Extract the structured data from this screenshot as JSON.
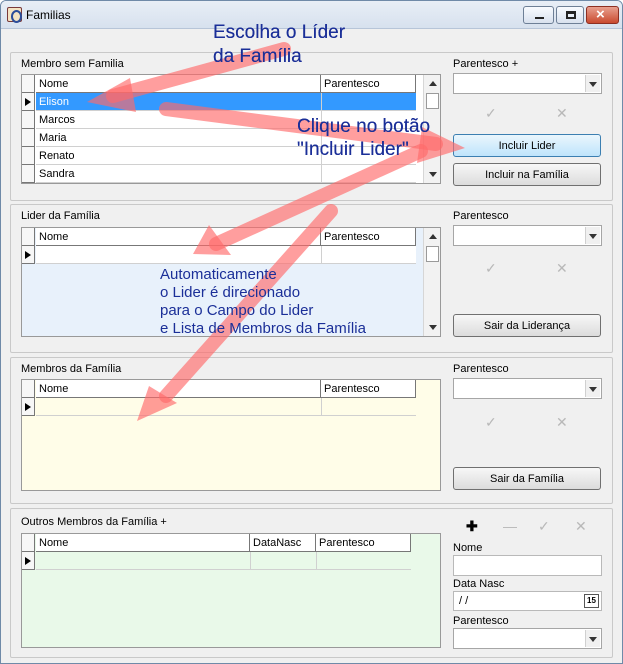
{
  "window": {
    "title": "Familias"
  },
  "membro_sem_familia": {
    "label": "Membro sem Familia",
    "columns": [
      "Nome",
      "Parentesco"
    ],
    "rows": [
      {
        "nome": "Elison",
        "parentesco": ""
      },
      {
        "nome": "Marcos",
        "parentesco": ""
      },
      {
        "nome": "Maria",
        "parentesco": ""
      },
      {
        "nome": "Renato",
        "parentesco": ""
      },
      {
        "nome": "Sandra",
        "parentesco": ""
      }
    ]
  },
  "parentesco_plus": {
    "label": "Parentesco +",
    "value": ""
  },
  "buttons": {
    "incluir_lider": "Incluir Lider",
    "incluir_familia": "Incluir na Família",
    "sair_lideranca": "Sair da Liderança",
    "sair_familia": "Sair da Família"
  },
  "lider": {
    "label": "Lider da Família",
    "columns": [
      "Nome",
      "Parentesco"
    ]
  },
  "parentesco2": {
    "label": "Parentesco",
    "value": ""
  },
  "membros": {
    "label": "Membros da Família",
    "columns": [
      "Nome",
      "Parentesco"
    ]
  },
  "parentesco3": {
    "label": "Parentesco",
    "value": ""
  },
  "outros": {
    "label": "Outros Membros da Família +",
    "columns": [
      "Nome",
      "DataNasc",
      "Parentesco"
    ]
  },
  "form": {
    "nome_label": "Nome",
    "nome_value": "",
    "datanasc_label": "Data Nasc",
    "datanasc_value": " / /",
    "calendar_text": "15",
    "parentesco_label": "Parentesco",
    "parentesco_value": ""
  },
  "annotations": {
    "escolha_1": "Escolha o Líder",
    "escolha_2": "da Família",
    "clique_1": "Clique no botão",
    "clique_2": "\"Incluir Lider\"",
    "auto_1": "Automaticamente",
    "auto_2": "o Lider é direcionado",
    "auto_3": "para o Campo do Lider",
    "auto_4": "e Lista de Membros da Família"
  },
  "icons": {
    "app": "app-icon",
    "confirm": "check-icon",
    "cancel": "x-icon",
    "add": "plus-icon",
    "minus": "minus-icon"
  },
  "colors": {
    "selected": "#3399ff",
    "annotation": "#1b2f98",
    "arrow": "#ff6a6a"
  }
}
